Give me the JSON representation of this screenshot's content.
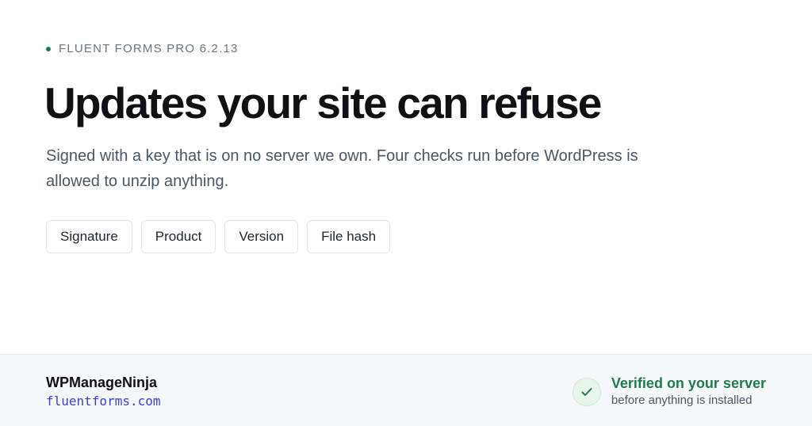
{
  "eyebrow": {
    "text": "FLUENT FORMS PRO 6.2.13",
    "dot_color": "#1f7a4d"
  },
  "headline": "Updates your site can refuse",
  "subtitle": "Signed with a key that is on no server we own. Four checks run before WordPress is allowed to unzip anything.",
  "checks": [
    {
      "label": "Signature"
    },
    {
      "label": "Product"
    },
    {
      "label": "Version"
    },
    {
      "label": "File hash"
    }
  ],
  "footer": {
    "vendor_name": "WPManageNinja",
    "vendor_site": "fluentforms.com",
    "verified_title": "Verified on your server",
    "verified_subtitle": "before anything is installed",
    "badge_icon": "checkmark-icon"
  },
  "colors": {
    "accent_green": "#1f7a4d",
    "link_blue": "#3b3fc9",
    "heading": "#111113",
    "footer_bg": "#f7f8fa"
  }
}
